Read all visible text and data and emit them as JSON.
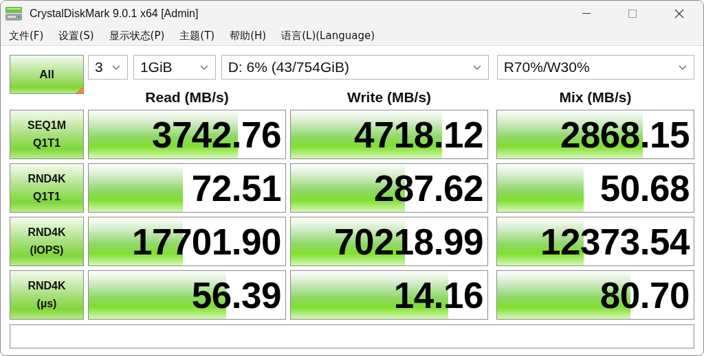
{
  "window": {
    "title": "CrystalDiskMark 9.0.1 x64 [Admin]"
  },
  "menu": [
    "文件(F)",
    "设置(S)",
    "显示状态(P)",
    "主题(T)",
    "帮助(H)",
    "语言(L)(Language)"
  ],
  "controls": {
    "all_button": "All",
    "count": "3",
    "size": "1GiB",
    "drive": "D: 6% (43/754GiB)",
    "mix_ratio": "R70%/W30%"
  },
  "columns": [
    "Read (MB/s)",
    "Write (MB/s)",
    "Mix (MB/s)"
  ],
  "rows": [
    {
      "label": [
        "SEQ1M",
        "Q1T1"
      ],
      "results": [
        {
          "value": "3742.76",
          "level": 0.76
        },
        {
          "value": "4718.12",
          "level": 0.77
        },
        {
          "value": "2868.15",
          "level": 0.74
        }
      ]
    },
    {
      "label": [
        "RND4K",
        "Q1T1"
      ],
      "results": [
        {
          "value": "72.51",
          "level": 0.48
        },
        {
          "value": "287.62",
          "level": 0.58
        },
        {
          "value": "50.68",
          "level": 0.44
        }
      ]
    },
    {
      "label": [
        "RND4K",
        "(IOPS)"
      ],
      "results": [
        {
          "value": "17701.90",
          "level": 0.48
        },
        {
          "value": "70218.99",
          "level": 0.58
        },
        {
          "value": "12373.54",
          "level": 0.44
        }
      ]
    },
    {
      "label": [
        "RND4K",
        "(µs)"
      ],
      "results": [
        {
          "value": "56.39",
          "level": 0.7
        },
        {
          "value": "14.16",
          "level": 0.8
        },
        {
          "value": "80.70",
          "level": 0.68
        }
      ]
    }
  ]
}
